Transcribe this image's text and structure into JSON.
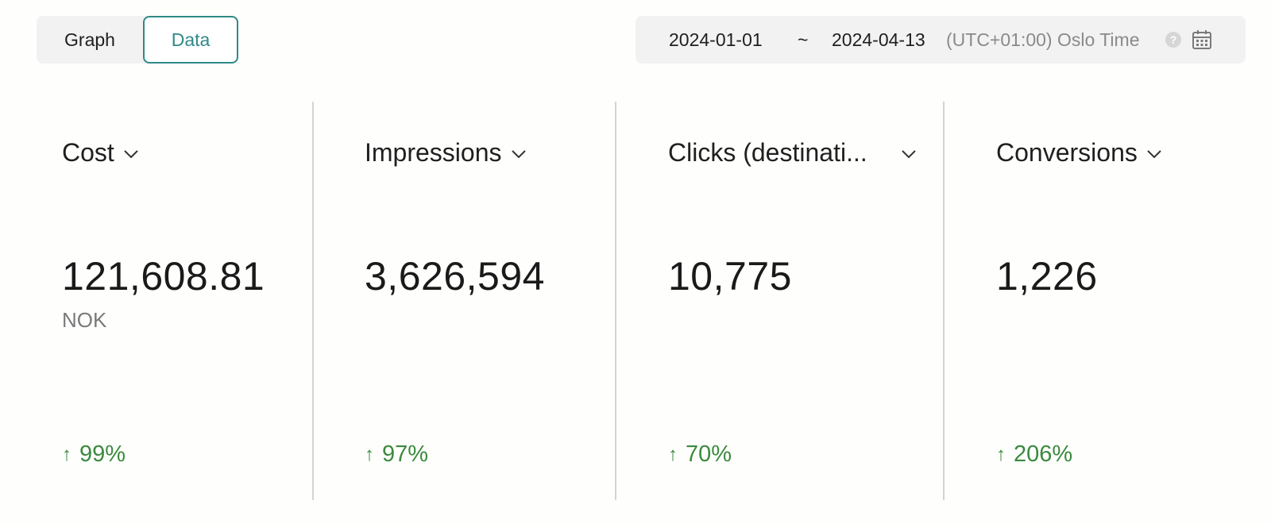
{
  "view_toggle": {
    "graph_label": "Graph",
    "data_label": "Data",
    "selected": "Data"
  },
  "date_range": {
    "start": "2024-01-01",
    "separator": "~",
    "end": "2024-04-13",
    "timezone": "(UTC+01:00) Oslo Time",
    "help_icon": "help-icon",
    "calendar_icon": "calendar-icon"
  },
  "metrics": [
    {
      "name": "Cost",
      "value": "121,608.81",
      "unit": "NOK",
      "change": "99%"
    },
    {
      "name": "Impressions",
      "value": "3,626,594",
      "unit": "",
      "change": "97%"
    },
    {
      "name": "Clicks (destinati...",
      "value": "10,775",
      "unit": "",
      "change": "70%"
    },
    {
      "name": "Conversions",
      "value": "1,226",
      "unit": "",
      "change": "206%"
    }
  ],
  "colors": {
    "accent": "#2f8a87",
    "positive": "#3b8a3d",
    "muted": "#8a8a8a"
  }
}
